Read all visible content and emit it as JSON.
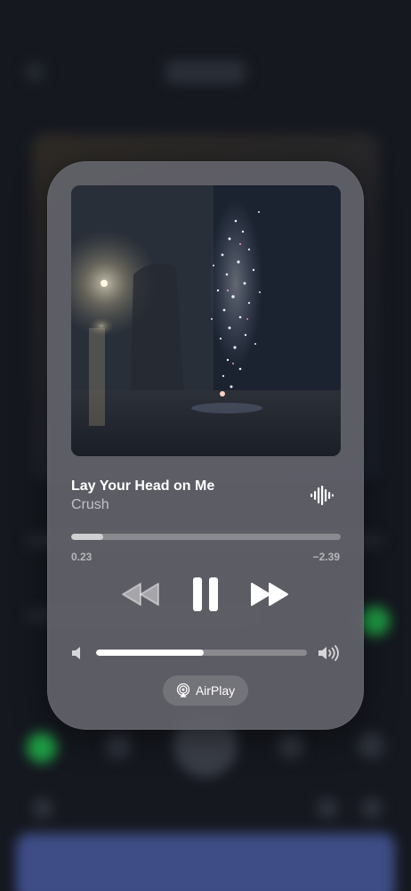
{
  "now_playing": {
    "title": "Lay Your Head on Me",
    "artist": "Crush",
    "elapsed": "0.23",
    "remaining": "−2.39",
    "progress": 0.12,
    "volume": 0.51,
    "airplay_label": "AirPlay"
  },
  "icons": {
    "wave": "waveform-icon",
    "rewind": "rewind-icon",
    "pause": "pause-icon",
    "forward": "fast-forward-icon",
    "volume_low": "speaker-low-icon",
    "volume_high": "speaker-high-icon",
    "airplay": "airplay-icon"
  },
  "colors": {
    "card": "#62626a",
    "text_primary": "#ffffff",
    "background": "#15181f"
  }
}
